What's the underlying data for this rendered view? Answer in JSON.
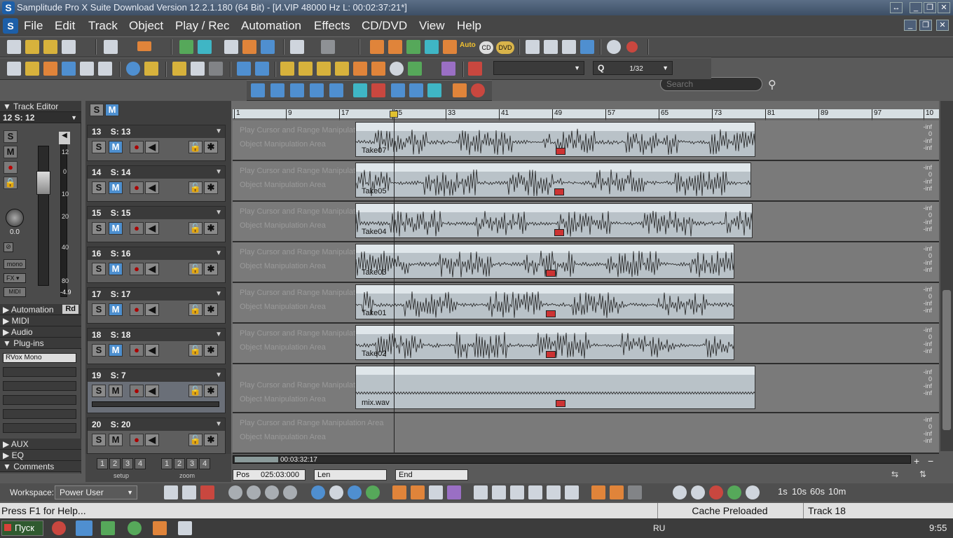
{
  "window": {
    "title": "Samplitude Pro X Suite Download Version 12.2.1.180 (64 Bit) - [И.VIP   48000 Hz L: 00:02:37:21*]"
  },
  "menu": [
    "File",
    "Edit",
    "Track",
    "Object",
    "Play / Rec",
    "Automation",
    "Effects",
    "CD/DVD",
    "View",
    "Help"
  ],
  "search": {
    "placeholder": "Search"
  },
  "toolbar": {
    "grid_value": "",
    "quantize_label": "Q",
    "quantize_value": "1/32",
    "cd_label": "CD",
    "dvd_label": "DVD",
    "auto_label": "Auto"
  },
  "left_panel": {
    "header": "Track Editor",
    "track": "12   S: 12",
    "pan_value": "0.0",
    "scale": [
      "12",
      "0",
      "10",
      "20",
      "40",
      "80"
    ],
    "level": "-4.9",
    "mono": "mono",
    "fx": "FX",
    "midi_btn": "MIDI",
    "sections": [
      "Automation",
      "MIDI",
      "Audio",
      "Plug-ins",
      "AUX",
      "EQ",
      "Comments"
    ],
    "automation_mode": "Rd",
    "plugin": "RVox Mono"
  },
  "header_bar": {
    "solo": "S",
    "mute": "M"
  },
  "ruler": [
    "1",
    "9",
    "17",
    "25",
    "33",
    "41",
    "49",
    "57",
    "65",
    "73",
    "81",
    "89",
    "97",
    "10"
  ],
  "lane_hints": {
    "cursor": "Play Cursor and Range Manipulation Area",
    "object": "Object Manipulation Area"
  },
  "tracks": [
    {
      "num": "13",
      "name": "S: 13",
      "clip": "Take07"
    },
    {
      "num": "14",
      "name": "S: 14",
      "clip": "Take05"
    },
    {
      "num": "15",
      "name": "S: 15",
      "clip": "Take04"
    },
    {
      "num": "16",
      "name": "S: 16",
      "clip": "Take03"
    },
    {
      "num": "17",
      "name": "S: 17",
      "clip": "Take01"
    },
    {
      "num": "18",
      "name": "S: 18",
      "clip": "Take02"
    },
    {
      "num": "19",
      "name": "S: 7",
      "clip": "mix.wav"
    },
    {
      "num": "20",
      "name": "S: 20",
      "clip": ""
    }
  ],
  "track_buttons": {
    "solo": "S",
    "mute": "M"
  },
  "vol_labels": [
    "-inf",
    "0",
    "-inf"
  ],
  "numbers": [
    "1",
    "2",
    "3",
    "4"
  ],
  "setup_label": "setup",
  "zoom_label": "zoom",
  "transport": {
    "time": "00:03:32:17",
    "pos_label": "Pos",
    "pos_value": "025:03:000",
    "len_label": "Len",
    "end_label": "End"
  },
  "workspace": {
    "label": "Workspace:",
    "value": "Power User"
  },
  "zoom_presets": [
    "1s",
    "10s",
    "60s",
    "10m"
  ],
  "status": {
    "help": "Press F1 for Help...",
    "cache": "Cache Preloaded",
    "track": "Track 18"
  },
  "taskbar": {
    "start": "Пуск",
    "lang": "RU",
    "clock": "9:55"
  }
}
